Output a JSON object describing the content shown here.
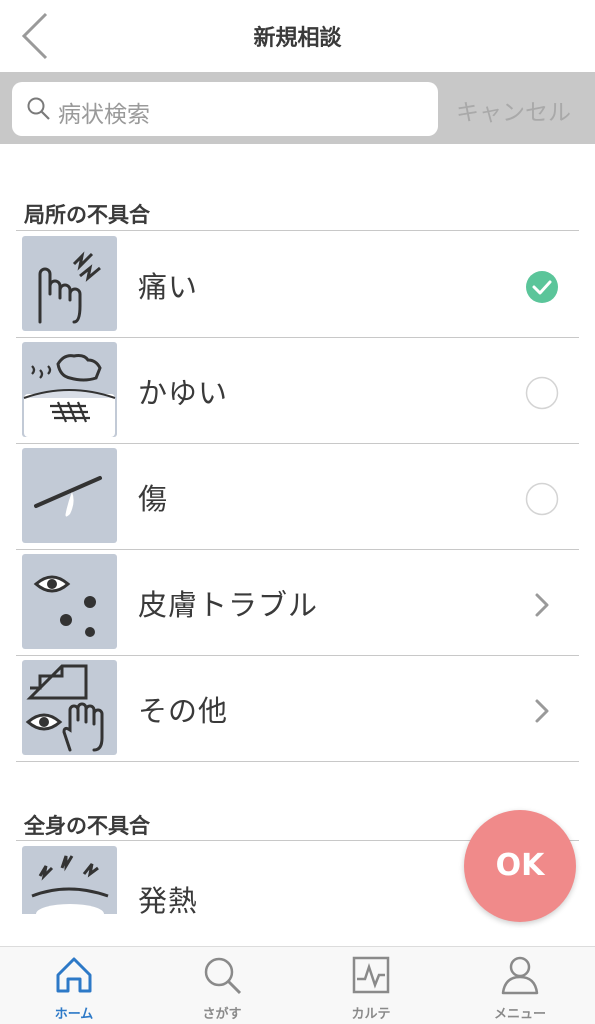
{
  "header": {
    "title": "新規相談"
  },
  "search": {
    "placeholder": "病状検索",
    "cancel_label": "キャンセル"
  },
  "sections": [
    {
      "title": "局所の不具合",
      "items": [
        {
          "label": "痛い",
          "icon": "finger-pain-icon",
          "control": "checked"
        },
        {
          "label": "かゆい",
          "icon": "scratching-hand-icon",
          "control": "radio"
        },
        {
          "label": "傷",
          "icon": "wound-icon",
          "control": "radio"
        },
        {
          "label": "皮膚トラブル",
          "icon": "skin-spots-icon",
          "control": "chevron"
        },
        {
          "label": "その他",
          "icon": "other-symptoms-icon",
          "control": "chevron"
        }
      ]
    },
    {
      "title": "全身の不具合",
      "items": [
        {
          "label": "発熱",
          "icon": "fever-head-icon",
          "control": "none"
        }
      ]
    }
  ],
  "ok_button": {
    "label": "OK"
  },
  "tabbar": {
    "tabs": [
      {
        "label": "ホーム",
        "icon": "home-icon",
        "active": true
      },
      {
        "label": "さがす",
        "icon": "search-icon",
        "active": false
      },
      {
        "label": "カルテ",
        "icon": "chart-record-icon",
        "active": false
      },
      {
        "label": "メニュー",
        "icon": "user-menu-icon",
        "active": false
      }
    ]
  },
  "colors": {
    "accent_check": "#5bc59a",
    "ok_button": "#f08a8a",
    "active_tab": "#2d79c7",
    "thumb_bg": "#c2cad6"
  }
}
